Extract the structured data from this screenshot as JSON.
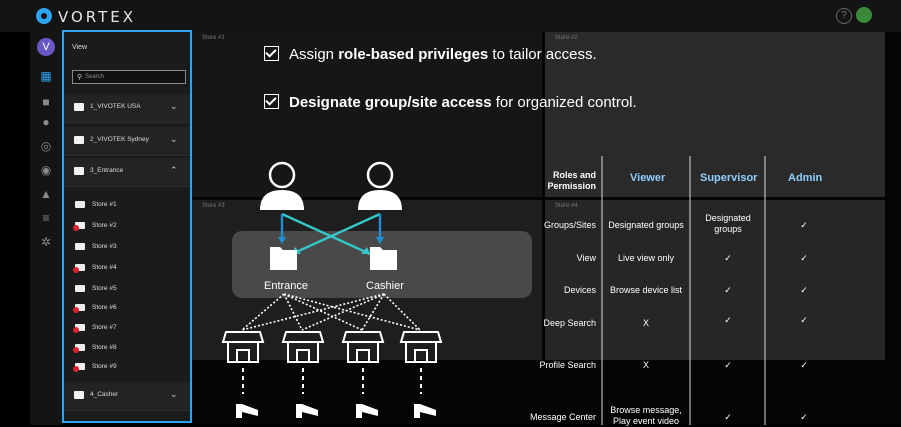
{
  "app": {
    "logo_text": "VORTEX",
    "user_initial": "V"
  },
  "sidebar": {
    "title": "View",
    "search_placeholder": "Search",
    "groups": [
      {
        "label": "1_VIVOTEK USA",
        "chev": "⌄"
      },
      {
        "label": "2_VIVOTEK Sydney",
        "chev": "⌄"
      },
      {
        "label": "3_Entrance",
        "chev": "⌃"
      },
      {
        "label": "4_Casher",
        "chev": "⌄"
      }
    ],
    "cameras": [
      {
        "label": "Store #1",
        "status": "ok"
      },
      {
        "label": "Store #2",
        "status": "error"
      },
      {
        "label": "Store #3",
        "status": "ok"
      },
      {
        "label": "Store #4",
        "status": "error"
      },
      {
        "label": "Store #5",
        "status": "ok"
      },
      {
        "label": "Store #6",
        "status": "error"
      },
      {
        "label": "Store #7",
        "status": "error"
      },
      {
        "label": "Store #8",
        "status": "error"
      },
      {
        "label": "Store #9",
        "status": "error"
      }
    ]
  },
  "tiles": {
    "t1": "Store #1",
    "t2": "Store #2",
    "t3": "Store #3",
    "t4": "Store #4"
  },
  "slide": {
    "point1": {
      "pre": "Assign ",
      "bold": "role-based privileges",
      "post": " to tailor access."
    },
    "point2": {
      "bold": "Designate group/site access",
      "post": " for organized control."
    },
    "nodes": {
      "entrance": "Entrance",
      "cashier": "Cashier"
    },
    "table": {
      "roles_label": "Roles and Permission",
      "headers": [
        "Viewer",
        "Supervisor",
        "Admin"
      ],
      "rows": [
        {
          "label": "Groups/Sites",
          "viewer": "Designated groups",
          "supervisor": "Designated groups",
          "admin": "✓"
        },
        {
          "label": "View",
          "viewer": "Live view only",
          "supervisor": "✓",
          "admin": "✓"
        },
        {
          "label": "Devices",
          "viewer": "Browse device list",
          "supervisor": "✓",
          "admin": "✓"
        },
        {
          "label": "Deep Search",
          "viewer": "X",
          "supervisor": "✓",
          "admin": "✓"
        },
        {
          "label": "Profile Search",
          "viewer": "X",
          "supervisor": "✓",
          "admin": "✓"
        },
        {
          "label": "Message Center",
          "viewer": "Browse message, Play event video",
          "supervisor": "✓",
          "admin": "✓"
        }
      ]
    }
  },
  "colors": {
    "accent": "#2ea3f2",
    "header_text": "#8fd0ff",
    "error": "#d9232e",
    "arrow": "#35c6c9"
  }
}
